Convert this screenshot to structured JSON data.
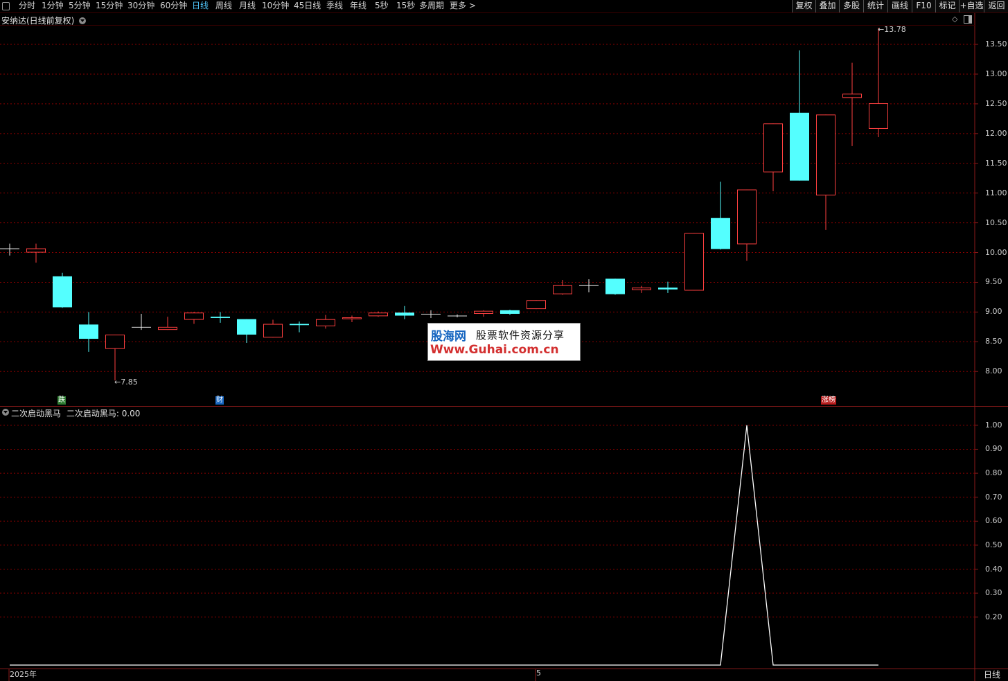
{
  "toolbar": {
    "periods": [
      "分时",
      "1分钟",
      "5分钟",
      "15分钟",
      "30分钟",
      "60分钟",
      "日线",
      "周线",
      "月线",
      "10分钟",
      "45日线",
      "季线",
      "年线",
      "5秒",
      "15秒",
      "多周期",
      "更多 >"
    ],
    "active_period": "日线",
    "right_buttons": [
      "复权",
      "叠加",
      "多股",
      "统计",
      "画线",
      "F10",
      "标记",
      "+自选",
      "返回"
    ]
  },
  "main_chart": {
    "title": "安纳达(日线前复权)",
    "high_annotation": "13.78",
    "low_annotation": "7.85",
    "markers": [
      {
        "text": "跌",
        "color": "#2e7d32",
        "date_index": 2
      },
      {
        "text": "财",
        "color": "#1565c0",
        "date_index": 8
      },
      {
        "text": "涨榜",
        "color": "#b71c1c",
        "date_index": 31
      }
    ],
    "watermark": {
      "brand": "股海网",
      "slogan": "股票软件资源分享",
      "url": "Www.Guhai.com.cn"
    }
  },
  "indicator": {
    "title": "二次启动黑马",
    "value_label": "二次启动黑马: 0.00"
  },
  "x_axis": {
    "labels": [
      {
        "text": "2025年",
        "date_index": 0
      },
      {
        "text": "5",
        "date_index": 20
      }
    ]
  },
  "period_label": "日线",
  "colors": {
    "up": "#ff4040",
    "down": "#54ffff",
    "flat": "#e8e8e8",
    "grid": "#8b0000",
    "line": "#ffffff"
  },
  "chart_data": [
    {
      "type": "candlestick",
      "title": "安纳达(日线前复权)",
      "ylim": [
        7.7,
        13.85
      ],
      "yticks": [
        8.0,
        8.5,
        9.0,
        9.5,
        10.0,
        10.5,
        11.0,
        11.5,
        12.0,
        12.5,
        13.0,
        13.5
      ],
      "candles": [
        {
          "o": 10.07,
          "h": 10.15,
          "l": 9.95,
          "c": 10.07
        },
        {
          "o": 10.0,
          "h": 10.15,
          "l": 9.83,
          "c": 10.07
        },
        {
          "o": 9.6,
          "h": 9.66,
          "l": 9.07,
          "c": 9.08
        },
        {
          "o": 8.79,
          "h": 9.0,
          "l": 8.33,
          "c": 8.55
        },
        {
          "o": 8.38,
          "h": 8.62,
          "l": 7.85,
          "c": 8.62
        },
        {
          "o": 8.75,
          "h": 8.97,
          "l": 8.7,
          "c": 8.75
        },
        {
          "o": 8.7,
          "h": 8.92,
          "l": 8.7,
          "c": 8.75
        },
        {
          "o": 8.87,
          "h": 9.0,
          "l": 8.8,
          "c": 8.99
        },
        {
          "o": 8.92,
          "h": 9.0,
          "l": 8.82,
          "c": 8.9
        },
        {
          "o": 8.88,
          "h": 8.88,
          "l": 8.48,
          "c": 8.62
        },
        {
          "o": 8.57,
          "h": 8.87,
          "l": 8.57,
          "c": 8.8
        },
        {
          "o": 8.8,
          "h": 8.84,
          "l": 8.66,
          "c": 8.78
        },
        {
          "o": 8.76,
          "h": 8.95,
          "l": 8.72,
          "c": 8.88
        },
        {
          "o": 8.88,
          "h": 8.94,
          "l": 8.83,
          "c": 8.91
        },
        {
          "o": 8.93,
          "h": 9.01,
          "l": 8.92,
          "c": 8.99
        },
        {
          "o": 8.99,
          "h": 9.1,
          "l": 8.88,
          "c": 8.94
        },
        {
          "o": 8.97,
          "h": 9.03,
          "l": 8.9,
          "c": 8.97
        },
        {
          "o": 8.94,
          "h": 8.96,
          "l": 8.91,
          "c": 8.94
        },
        {
          "o": 8.97,
          "h": 9.03,
          "l": 8.92,
          "c": 9.02
        },
        {
          "o": 9.03,
          "h": 9.04,
          "l": 8.95,
          "c": 8.97
        },
        {
          "o": 9.05,
          "h": 9.2,
          "l": 9.05,
          "c": 9.2
        },
        {
          "o": 9.3,
          "h": 9.54,
          "l": 9.29,
          "c": 9.45
        },
        {
          "o": 9.45,
          "h": 9.55,
          "l": 9.33,
          "c": 9.45
        },
        {
          "o": 9.56,
          "h": 9.56,
          "l": 9.29,
          "c": 9.3
        },
        {
          "o": 9.37,
          "h": 9.44,
          "l": 9.32,
          "c": 9.41
        },
        {
          "o": 9.41,
          "h": 9.51,
          "l": 9.32,
          "c": 9.38
        },
        {
          "o": 9.36,
          "h": 10.33,
          "l": 9.36,
          "c": 10.33
        },
        {
          "o": 10.58,
          "h": 11.19,
          "l": 10.05,
          "c": 10.06
        },
        {
          "o": 10.14,
          "h": 11.06,
          "l": 9.86,
          "c": 11.06
        },
        {
          "o": 11.35,
          "h": 12.17,
          "l": 11.03,
          "c": 12.17
        },
        {
          "o": 12.35,
          "h": 13.4,
          "l": 11.21,
          "c": 11.21
        },
        {
          "o": 10.96,
          "h": 12.32,
          "l": 10.38,
          "c": 12.32
        },
        {
          "o": 12.6,
          "h": 13.19,
          "l": 11.79,
          "c": 12.67
        },
        {
          "o": 12.08,
          "h": 13.78,
          "l": 11.94,
          "c": 12.51
        }
      ]
    },
    {
      "type": "line",
      "title": "二次启动黑马",
      "ylim": [
        0,
        1.04
      ],
      "yticks": [
        0.2,
        0.3,
        0.4,
        0.5,
        0.6,
        0.7,
        0.8,
        0.9,
        1.0
      ],
      "series": [
        {
          "name": "二次启动黑马",
          "values": [
            0,
            0,
            0,
            0,
            0,
            0,
            0,
            0,
            0,
            0,
            0,
            0,
            0,
            0,
            0,
            0,
            0,
            0,
            0,
            0,
            0,
            0,
            0,
            0,
            0,
            0,
            0,
            0,
            1,
            0,
            0,
            0,
            0,
            0
          ]
        }
      ]
    }
  ]
}
